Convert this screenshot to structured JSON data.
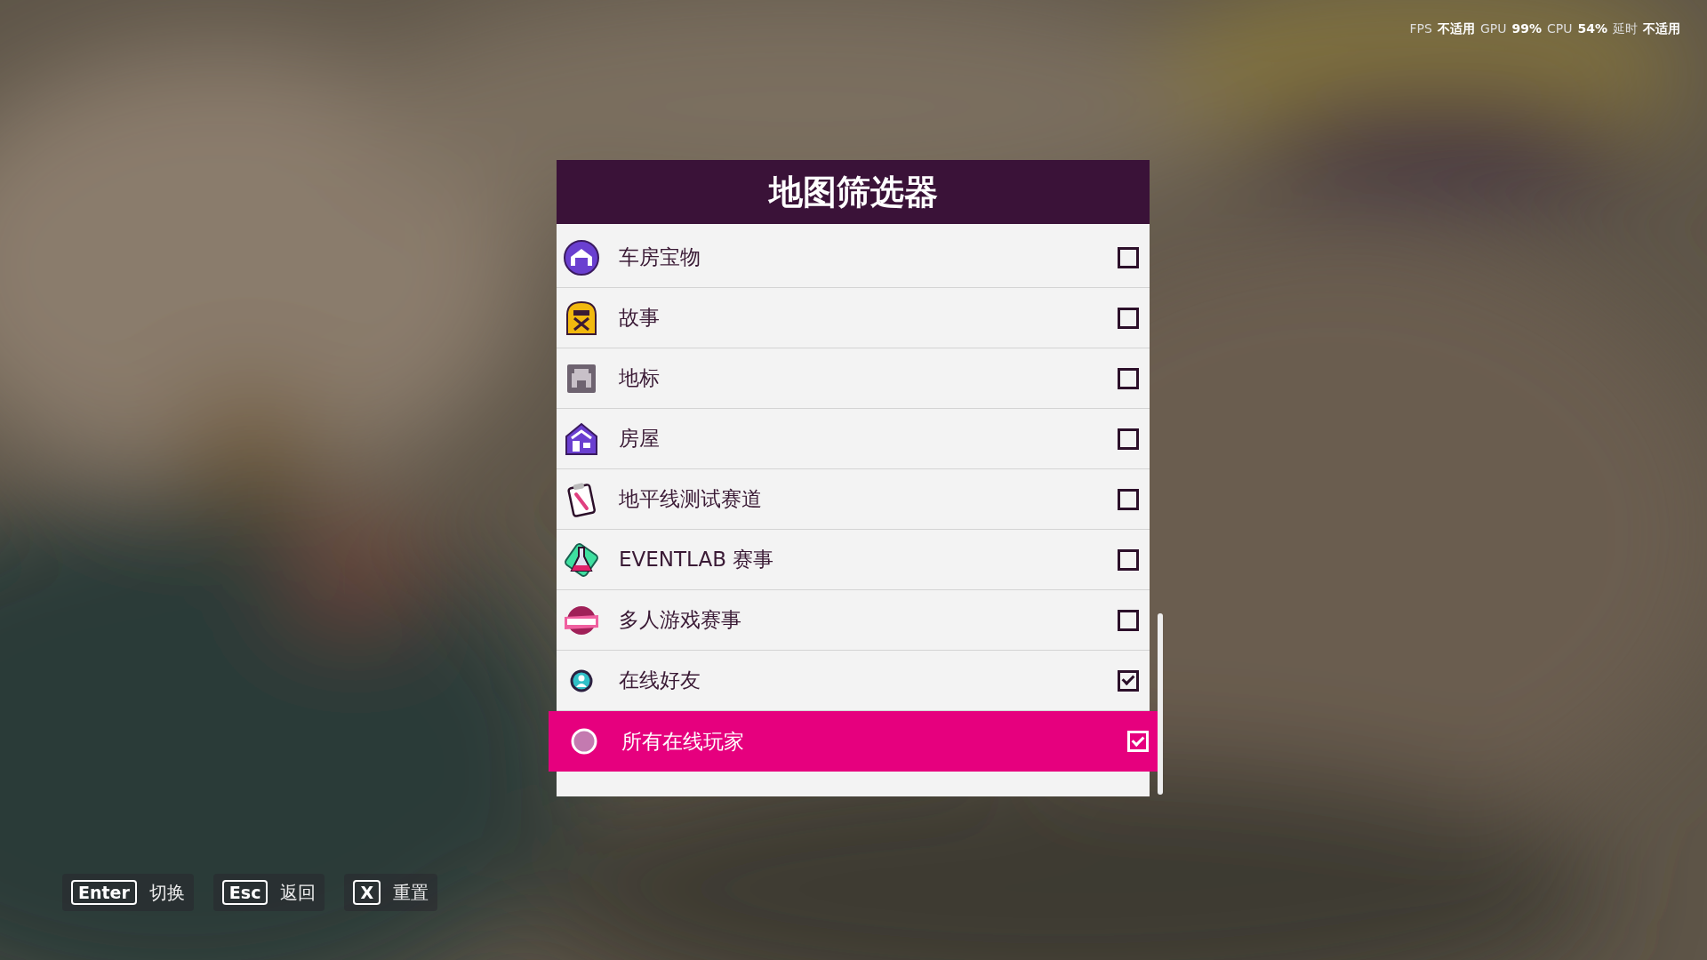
{
  "stats": [
    {
      "label": "FPS",
      "value": "不适用"
    },
    {
      "label": "GPU",
      "value": "99%"
    },
    {
      "label": "CPU",
      "value": "54%"
    },
    {
      "label": "延时",
      "value": "不适用"
    }
  ],
  "panel": {
    "title": "地图筛选器"
  },
  "filters": [
    {
      "label": "车房宝物",
      "checked": false,
      "selected": false
    },
    {
      "label": "故事",
      "checked": false,
      "selected": false
    },
    {
      "label": "地标",
      "checked": false,
      "selected": false
    },
    {
      "label": "房屋",
      "checked": false,
      "selected": false
    },
    {
      "label": "地平线测试赛道",
      "checked": false,
      "selected": false
    },
    {
      "label": "EVENTLAB 赛事",
      "checked": false,
      "selected": false
    },
    {
      "label": "多人游戏赛事",
      "checked": false,
      "selected": false
    },
    {
      "label": "在线好友",
      "checked": true,
      "selected": false
    },
    {
      "label": "所有在线玩家",
      "checked": true,
      "selected": true
    }
  ],
  "hints": [
    {
      "key": "Enter",
      "action": "切换"
    },
    {
      "key": "Esc",
      "action": "返回"
    },
    {
      "key": "X",
      "action": "重置"
    }
  ]
}
